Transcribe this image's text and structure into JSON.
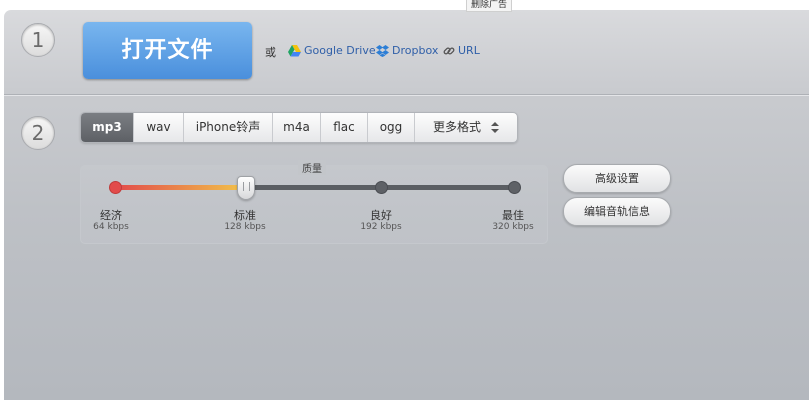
{
  "ad_tab": {
    "label": "删除广告"
  },
  "steps": {
    "one": "1",
    "two": "2"
  },
  "open_file": {
    "label": "打开文件"
  },
  "or_text": "或",
  "sources": {
    "google_drive": {
      "label": "Google Drive",
      "icon": "google-drive-icon"
    },
    "dropbox": {
      "label": "Dropbox",
      "icon": "dropbox-icon"
    },
    "url": {
      "label": "URL",
      "icon": "link-icon"
    }
  },
  "formats": {
    "selected": "mp3",
    "items": [
      {
        "label": "mp3"
      },
      {
        "label": "wav"
      },
      {
        "label": "iPhone铃声"
      },
      {
        "label": "m4a"
      },
      {
        "label": "flac"
      },
      {
        "label": "ogg"
      },
      {
        "label": "更多格式"
      }
    ]
  },
  "quality": {
    "title": "质量",
    "selected_index": 1,
    "levels": [
      {
        "label": "经济",
        "rate": "64 kbps"
      },
      {
        "label": "标准",
        "rate": "128 kbps"
      },
      {
        "label": "良好",
        "rate": "192 kbps"
      },
      {
        "label": "最佳",
        "rate": "320 kbps"
      }
    ]
  },
  "buttons": {
    "advanced": "高级设置",
    "edit_track": "编辑音轨信息"
  },
  "colors": {
    "accent_blue": "#4a8fdc",
    "link_blue": "#2f5fa8",
    "slider_red": "#e24b4b",
    "slider_yellow": "#f2c34a"
  }
}
